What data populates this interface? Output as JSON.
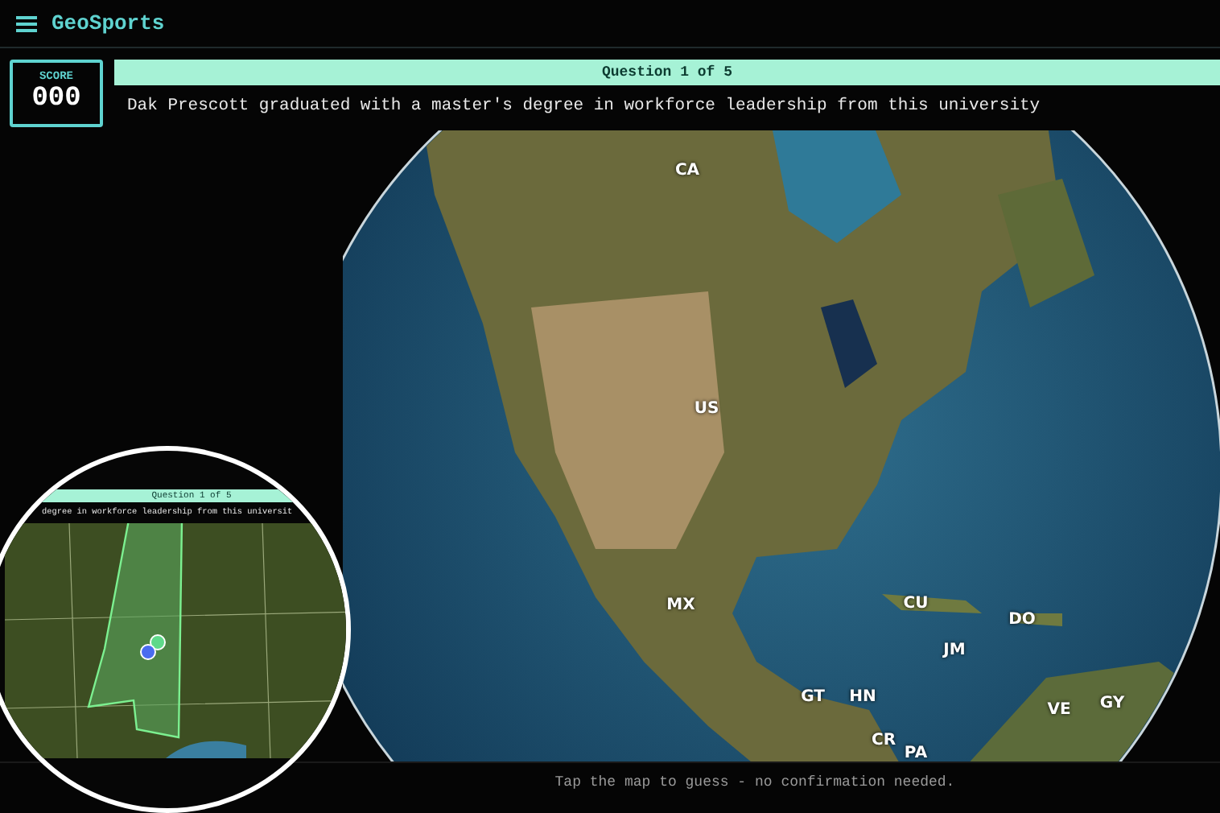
{
  "header": {
    "title": "GeoSports"
  },
  "score": {
    "label": "SCORE",
    "value": "000"
  },
  "question": {
    "progress": "Question 1 of 5",
    "text": "Dak Prescott graduated with a master's degree in workforce leadership from this university"
  },
  "map": {
    "labels": [
      "CA",
      "US",
      "MX",
      "CU",
      "JM",
      "DO",
      "GT",
      "HN",
      "VE",
      "GY",
      "CR",
      "PA"
    ]
  },
  "inset": {
    "progress": "Question 1 of 5",
    "text": "degree in workforce leadership from this universit",
    "markers": [
      {
        "color": "#5fd98a"
      },
      {
        "color": "#4a6cf0"
      }
    ]
  },
  "footer": {
    "hint": "Tap the map to guess - no confirmation needed."
  }
}
